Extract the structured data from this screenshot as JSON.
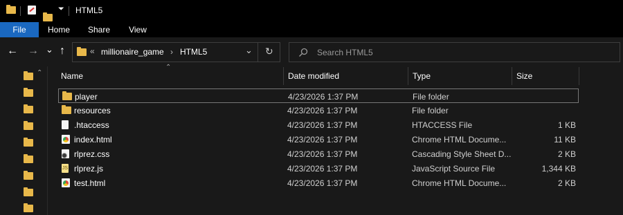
{
  "window": {
    "title": "HTML5"
  },
  "quick_access": {
    "icons": [
      "folder-icon",
      "properties-icon",
      "new-folder-icon",
      "customize-dropdown-icon"
    ]
  },
  "ribbon": {
    "tabs": [
      {
        "label": "File"
      },
      {
        "label": "Home"
      },
      {
        "label": "Share"
      },
      {
        "label": "View"
      }
    ]
  },
  "navigation": {
    "back_icon": "←",
    "forward_icon": "→",
    "recent_icon": "⌄",
    "up_icon": "↑",
    "refresh_icon": "↻"
  },
  "address": {
    "overflow": "«",
    "crumbs": [
      {
        "label": "millionaire_game"
      },
      {
        "label": "HTML5"
      }
    ],
    "separator": "›",
    "dropdown_icon": "⌄"
  },
  "search": {
    "placeholder": "Search HTML5"
  },
  "columns": {
    "name": "Name",
    "date": "Date modified",
    "type": "Type",
    "size": "Size"
  },
  "files": [
    {
      "name": "player",
      "date": "4/23/2026 1:37 PM",
      "type": "File folder",
      "size": "",
      "icon": "folder-icon",
      "selected": true
    },
    {
      "name": "resources",
      "date": "4/23/2026 1:37 PM",
      "type": "File folder",
      "size": "",
      "icon": "folder-icon"
    },
    {
      "name": ".htaccess",
      "date": "4/23/2026 1:37 PM",
      "type": "HTACCESS File",
      "size": "1 KB",
      "icon": "document-icon"
    },
    {
      "name": "index.html",
      "date": "4/23/2026 1:37 PM",
      "type": "Chrome HTML Docume...",
      "size": "11 KB",
      "icon": "chrome-html-icon"
    },
    {
      "name": "rlprez.css",
      "date": "4/23/2026 1:37 PM",
      "type": "Cascading Style Sheet D...",
      "size": "2 KB",
      "icon": "css-file-icon"
    },
    {
      "name": "rlprez.js",
      "date": "4/23/2026 1:37 PM",
      "type": "JavaScript Source File",
      "size": "1,344 KB",
      "icon": "js-file-icon"
    },
    {
      "name": "test.html",
      "date": "4/23/2026 1:37 PM",
      "type": "Chrome HTML Docume...",
      "size": "2 KB",
      "icon": "chrome-html-icon"
    }
  ],
  "colors": {
    "accent": "#1a68c0",
    "folder": "#e8b84a",
    "background": "#191919"
  }
}
